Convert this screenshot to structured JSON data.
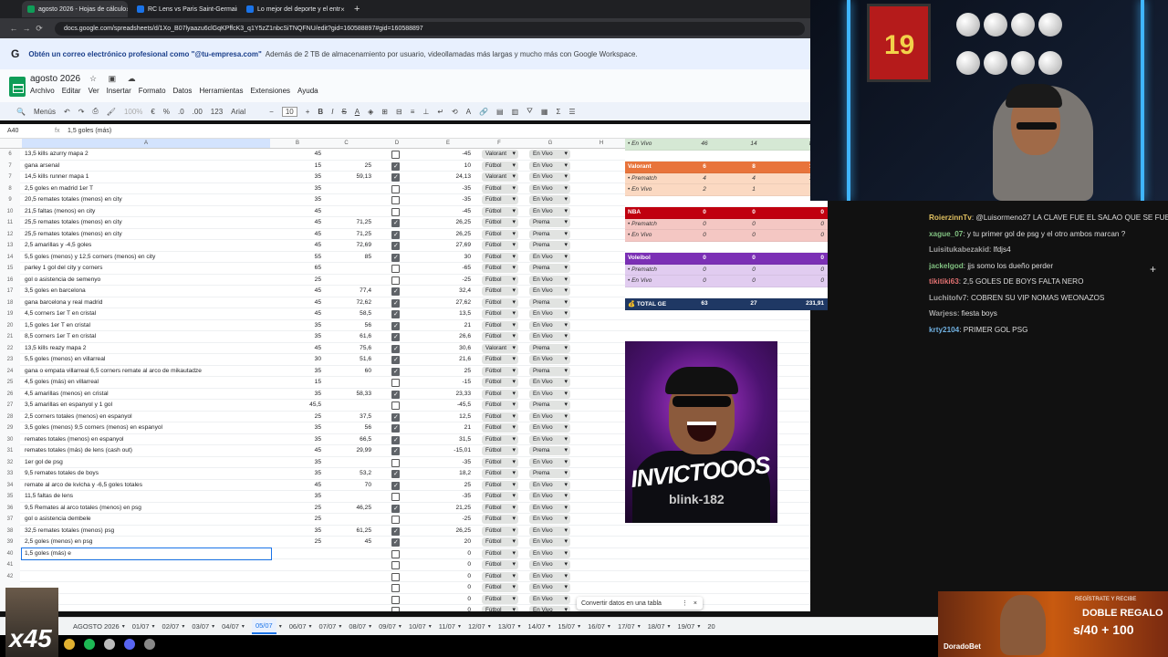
{
  "browser": {
    "tabs": [
      {
        "title": "agosto 2026 - Hojas de cálculo",
        "color": "#0f9d58"
      },
      {
        "title": "RC Lens vs Paris Saint-Germain",
        "color": "#1a73e8"
      },
      {
        "title": "Lo mejor del deporte y el entr",
        "color": "#1a73e8"
      }
    ],
    "url": "docs.google.com/spreadsheets/d/1Xo_B07lyaazu6clGqKPffcK3_q1Y5zZ1nbcSiTNQFNU/edit?gid=160588897#gid=160588897"
  },
  "banner": {
    "icon": "G",
    "bold": "Obtén un correo electrónico profesional como \"@tu-empresa.com\"",
    "rest": "Además de 2 TB de almacenamiento por usuario, videollamadas más largas y mucho más con Google Workspace."
  },
  "doc": {
    "title": "agosto 2026",
    "menu": [
      "Archivo",
      "Editar",
      "Ver",
      "Insertar",
      "Formato",
      "Datos",
      "Herramientas",
      "Extensiones",
      "Ayuda"
    ]
  },
  "toolbar": {
    "menus": "Menús",
    "zoom": "100%",
    "currency": "€",
    "percent": "%",
    "dec1": ".0",
    "dec2": ".00",
    "num": "123",
    "font": "Arial",
    "size": "10"
  },
  "formula": {
    "ref": "A40",
    "content": "1,5 goles (más)"
  },
  "columns": [
    "A",
    "B",
    "C",
    "D",
    "E",
    "F",
    "G",
    "H",
    "I",
    "J",
    "K",
    "L"
  ],
  "rows": [
    {
      "n": "6",
      "a": "13,5 kills azurry mapa 2",
      "b": "45",
      "c": "",
      "d": false,
      "e": "-45",
      "f": "Valorant",
      "g": "En Vivo"
    },
    {
      "n": "7",
      "a": "gana arsenal",
      "b": "15",
      "c": "25",
      "d": true,
      "e": "10",
      "f": "Fútbol",
      "g": "En Vivo"
    },
    {
      "n": "7",
      "a": "14,5 kills runner mapa 1",
      "b": "35",
      "c": "59,13",
      "d": true,
      "e": "24,13",
      "f": "Valorant",
      "g": "En Vivo"
    },
    {
      "n": "8",
      "a": "2,5 goles en madrid 1er T",
      "b": "35",
      "c": "",
      "d": false,
      "e": "-35",
      "f": "Fútbol",
      "g": "En Vivo"
    },
    {
      "n": "9",
      "a": "20,5 remates totales (menos) en city",
      "b": "35",
      "c": "",
      "d": false,
      "e": "-35",
      "f": "Fútbol",
      "g": "En Vivo"
    },
    {
      "n": "10",
      "a": "21,5 faltas (menos) en city",
      "b": "45",
      "c": "",
      "d": false,
      "e": "-45",
      "f": "Fútbol",
      "g": "En Vivo"
    },
    {
      "n": "11",
      "a": "25,5 remates totales (menos) en city",
      "b": "45",
      "c": "71,25",
      "d": true,
      "e": "26,25",
      "f": "Fútbol",
      "g": "Prema"
    },
    {
      "n": "12",
      "a": "25,5 remates totales (menos) en city",
      "b": "45",
      "c": "71,25",
      "d": true,
      "e": "26,25",
      "f": "Fútbol",
      "g": "Prema"
    },
    {
      "n": "13",
      "a": "2,5 amarillas y -4,5 goles",
      "b": "45",
      "c": "72,69",
      "d": true,
      "e": "27,69",
      "f": "Fútbol",
      "g": "Prema"
    },
    {
      "n": "14",
      "a": "5,5 goles (menos) y 12,5 corners (menos) en city",
      "b": "55",
      "c": "85",
      "d": true,
      "e": "30",
      "f": "Fútbol",
      "g": "En Vivo"
    },
    {
      "n": "15",
      "a": "parley 1 gol del city y corners",
      "b": "65",
      "c": "",
      "d": false,
      "e": "-65",
      "f": "Fútbol",
      "g": "Prema"
    },
    {
      "n": "16",
      "a": "gol o asistencia de semenyo",
      "b": "25",
      "c": "",
      "d": false,
      "e": "-25",
      "f": "Fútbol",
      "g": "En Vivo"
    },
    {
      "n": "17",
      "a": "3,5 goles en barcelona",
      "b": "45",
      "c": "77,4",
      "d": true,
      "e": "32,4",
      "f": "Fútbol",
      "g": "En Vivo"
    },
    {
      "n": "18",
      "a": "gana barcelona y real madrid",
      "b": "45",
      "c": "72,62",
      "d": true,
      "e": "27,62",
      "f": "Fútbol",
      "g": "Prema"
    },
    {
      "n": "19",
      "a": "4,5 corners 1er T en cristal",
      "b": "45",
      "c": "58,5",
      "d": true,
      "e": "13,5",
      "f": "Fútbol",
      "g": "En Vivo"
    },
    {
      "n": "20",
      "a": "1,5 goles 1er T en cristal",
      "b": "35",
      "c": "56",
      "d": true,
      "e": "21",
      "f": "Fútbol",
      "g": "En Vivo"
    },
    {
      "n": "21",
      "a": "8,5 corners 1er T en cristal",
      "b": "35",
      "c": "61,6",
      "d": true,
      "e": "26,6",
      "f": "Fútbol",
      "g": "En Vivo"
    },
    {
      "n": "22",
      "a": "13,5 kills reazy mapa 2",
      "b": "45",
      "c": "75,6",
      "d": true,
      "e": "30,6",
      "f": "Valorant",
      "g": "Prema"
    },
    {
      "n": "23",
      "a": "5,5 goles (menos) en villarreal",
      "b": "30",
      "c": "51,6",
      "d": true,
      "e": "21,6",
      "f": "Fútbol",
      "g": "En Vivo"
    },
    {
      "n": "24",
      "a": "gana o empata villarreal 6,5 corners remate al arco de mikautadze",
      "b": "35",
      "c": "60",
      "d": true,
      "e": "25",
      "f": "Fútbol",
      "g": "Prema"
    },
    {
      "n": "25",
      "a": "4,5 goles (más) en villarreal",
      "b": "15",
      "c": "",
      "d": false,
      "e": "-15",
      "f": "Fútbol",
      "g": "En Vivo"
    },
    {
      "n": "26",
      "a": "4,5 amarillas (menos) en cristal",
      "b": "35",
      "c": "58,33",
      "d": true,
      "e": "23,33",
      "f": "Fútbol",
      "g": "En Vivo"
    },
    {
      "n": "27",
      "a": "3,5 amarillas en espanyol y 1 gol",
      "b": "45,5",
      "c": "",
      "d": false,
      "e": "-45,5",
      "f": "Fútbol",
      "g": "Prema"
    },
    {
      "n": "28",
      "a": "2,5 corners totales (menos) en espanyol",
      "b": "25",
      "c": "37,5",
      "d": true,
      "e": "12,5",
      "f": "Fútbol",
      "g": "En Vivo"
    },
    {
      "n": "29",
      "a": "3,5 goles (menos) 9,5 corners (menos) en espanyol",
      "b": "35",
      "c": "56",
      "d": true,
      "e": "21",
      "f": "Fútbol",
      "g": "En Vivo"
    },
    {
      "n": "30",
      "a": "remates totales (menos) en espanyol",
      "b": "35",
      "c": "66,5",
      "d": true,
      "e": "31,5",
      "f": "Fútbol",
      "g": "En Vivo"
    },
    {
      "n": "31",
      "a": "remates totales (más) de lens (cash out)",
      "b": "45",
      "c": "29,99",
      "d": true,
      "e": "-15,01",
      "f": "Fútbol",
      "g": "Prema"
    },
    {
      "n": "32",
      "a": "1er gol de psg",
      "b": "35",
      "c": "",
      "d": false,
      "e": "-35",
      "f": "Fútbol",
      "g": "En Vivo"
    },
    {
      "n": "33",
      "a": "9,5 remates totales de boys",
      "b": "35",
      "c": "53,2",
      "d": true,
      "e": "18,2",
      "f": "Fútbol",
      "g": "Prema"
    },
    {
      "n": "34",
      "a": "remate al arco de kvicha y -6,5 goles totales",
      "b": "45",
      "c": "70",
      "d": true,
      "e": "25",
      "f": "Fútbol",
      "g": "En Vivo"
    },
    {
      "n": "35",
      "a": "11,5 faltas de lens",
      "b": "35",
      "c": "",
      "d": false,
      "e": "-35",
      "f": "Fútbol",
      "g": "En Vivo"
    },
    {
      "n": "36",
      "a": "9,5 Remates al arco totales (menos) en psg",
      "b": "25",
      "c": "46,25",
      "d": true,
      "e": "21,25",
      "f": "Fútbol",
      "g": "En Vivo"
    },
    {
      "n": "37",
      "a": "gol o asistencia dembele",
      "b": "25",
      "c": "",
      "d": false,
      "e": "-25",
      "f": "Fútbol",
      "g": "En Vivo"
    },
    {
      "n": "38",
      "a": "32,5 remates totales (menos) psg",
      "b": "35",
      "c": "61,25",
      "d": true,
      "e": "26,25",
      "f": "Fútbol",
      "g": "En Vivo"
    },
    {
      "n": "39",
      "a": "2,5 goles (menos) en psg",
      "b": "25",
      "c": "45",
      "d": true,
      "e": "20",
      "f": "Fútbol",
      "g": "En Vivo"
    },
    {
      "n": "40",
      "a": "1,5 goles (más) e",
      "b": "",
      "c": "",
      "d": false,
      "e": "0",
      "f": "Fútbol",
      "g": "En Vivo",
      "selected": true
    },
    {
      "n": "41",
      "a": "",
      "b": "",
      "c": "",
      "d": false,
      "e": "0",
      "f": "Fútbol",
      "g": "En Vivo"
    },
    {
      "n": "42",
      "a": "",
      "b": "",
      "c": "",
      "d": false,
      "e": "0",
      "f": "Fútbol",
      "g": "En Vivo"
    },
    {
      "n": "",
      "a": "",
      "b": "",
      "c": "",
      "d": false,
      "e": "0",
      "f": "Fútbol",
      "g": "En Vivo"
    },
    {
      "n": "",
      "a": "",
      "b": "",
      "c": "",
      "d": false,
      "e": "0",
      "f": "Fútbol",
      "g": "En Vivo"
    },
    {
      "n": "",
      "a": "",
      "b": "",
      "c": "",
      "d": false,
      "e": "0",
      "f": "Fútbol",
      "g": "En Vivo"
    }
  ],
  "summary": [
    {
      "label": "• En Vivo",
      "v1": "46",
      "v2": "14",
      "v3": "85,93",
      "bg": "#d5e8d4",
      "fg": "#333",
      "italic": true
    },
    {
      "label": "",
      "v1": "",
      "v2": "",
      "v3": "",
      "bg": "#ffffff",
      "fg": "#333"
    },
    {
      "label": "Valorant",
      "v1": "6",
      "v2": "8",
      "v3": "120,4",
      "bg": "#e8743b",
      "fg": "#fff",
      "bold": true
    },
    {
      "label": "• Prematch",
      "v1": "4",
      "v2": "4",
      "v3": "141,3",
      "bg": "#fbd9c2",
      "fg": "#333",
      "italic": true
    },
    {
      "label": "• En Vivo",
      "v1": "2",
      "v2": "1",
      "v3": "20,8",
      "bg": "#fbd9c2",
      "fg": "#333",
      "italic": true
    },
    {
      "label": "",
      "v1": "",
      "v2": "",
      "v3": "",
      "bg": "#ffffff",
      "fg": "#333"
    },
    {
      "label": "NBA",
      "v1": "0",
      "v2": "0",
      "v3": "0",
      "bg": "#c0000f",
      "fg": "#fff",
      "bold": true
    },
    {
      "label": "• Prematch",
      "v1": "0",
      "v2": "0",
      "v3": "0",
      "bg": "#f4c7c3",
      "fg": "#333",
      "italic": true
    },
    {
      "label": "• En Vivo",
      "v1": "0",
      "v2": "0",
      "v3": "0",
      "bg": "#f4c7c3",
      "fg": "#333",
      "italic": true
    },
    {
      "label": "",
      "v1": "",
      "v2": "",
      "v3": "",
      "bg": "#ffffff",
      "fg": "#333"
    },
    {
      "label": "Voleibol",
      "v1": "0",
      "v2": "0",
      "v3": "0",
      "bg": "#7b2fb5",
      "fg": "#fff",
      "bold": true
    },
    {
      "label": "• Prematch",
      "v1": "0",
      "v2": "0",
      "v3": "0",
      "bg": "#e1ccf0",
      "fg": "#333",
      "italic": true
    },
    {
      "label": "• En Vivo",
      "v1": "0",
      "v2": "0",
      "v3": "0",
      "bg": "#e1ccf0",
      "fg": "#333",
      "italic": true
    },
    {
      "label": "",
      "v1": "",
      "v2": "",
      "v3": "",
      "bg": "#ffffff",
      "fg": "#333"
    },
    {
      "label": "💰 TOTAL GE",
      "v1": "63",
      "v2": "27",
      "v3": "231,91",
      "bg": "#1f3864",
      "fg": "#fff",
      "bold": true
    }
  ],
  "image": {
    "text1": "INVICTOOOS",
    "text2": "blink-182"
  },
  "convert": {
    "label": "Convertir datos en una tabla",
    "more": "⋮",
    "close": "×"
  },
  "sheet_tabs": [
    "AGOSTO 2026",
    "01/07",
    "02/07",
    "03/07",
    "04/07",
    "05/07",
    "06/07",
    "07/07",
    "08/07",
    "09/07",
    "10/07",
    "11/07",
    "12/07",
    "13/07",
    "14/07",
    "15/07",
    "16/07",
    "17/07",
    "18/07",
    "19/07",
    "20"
  ],
  "active_sheet": "05/07",
  "overlay": {
    "multiplier": "x45"
  },
  "camera": {
    "jersey_number": "19"
  },
  "chat": [
    {
      "user": "RoierzinnTv",
      "color": "#e0c060",
      "text": ": @Luisormeno27 LA CLAVE FUE EL SALAO QUE SE FUE AL PSG , TODO BARÇA GANA CHAMPIONS"
    },
    {
      "user": "xague_07",
      "color": "#80c080",
      "text": ": y tu primer gol de psg y el otro ambos marcan ?"
    },
    {
      "user": "Luisitukabezakid",
      "color": "#a0a0a0",
      "text": ": lfdjs4"
    },
    {
      "user": "jackelgod",
      "color": "#80c080",
      "text": ": jjs somo los dueño perder"
    },
    {
      "user": "tikitiki63",
      "color": "#e07070",
      "text": ": 2,5 GOLES DE BOYS FALTA NERO"
    },
    {
      "user": "Luchitofv7",
      "color": "#a0a0a0",
      "text": ": COBREN SU VIP NOMAS WEONAZOS"
    },
    {
      "user": "Warjess",
      "color": "#a0a0a0",
      "text": ": fiesta boys"
    },
    {
      "user": "krty2104",
      "color": "#70b0e0",
      "text": ": PRIMER GOL PSG"
    }
  ],
  "ad": {
    "top": "REGÍSTRATE Y RECIBE",
    "headline": "DOBLE REGALO",
    "offer": "s/40 + 100",
    "brand": "DoradoBet"
  }
}
